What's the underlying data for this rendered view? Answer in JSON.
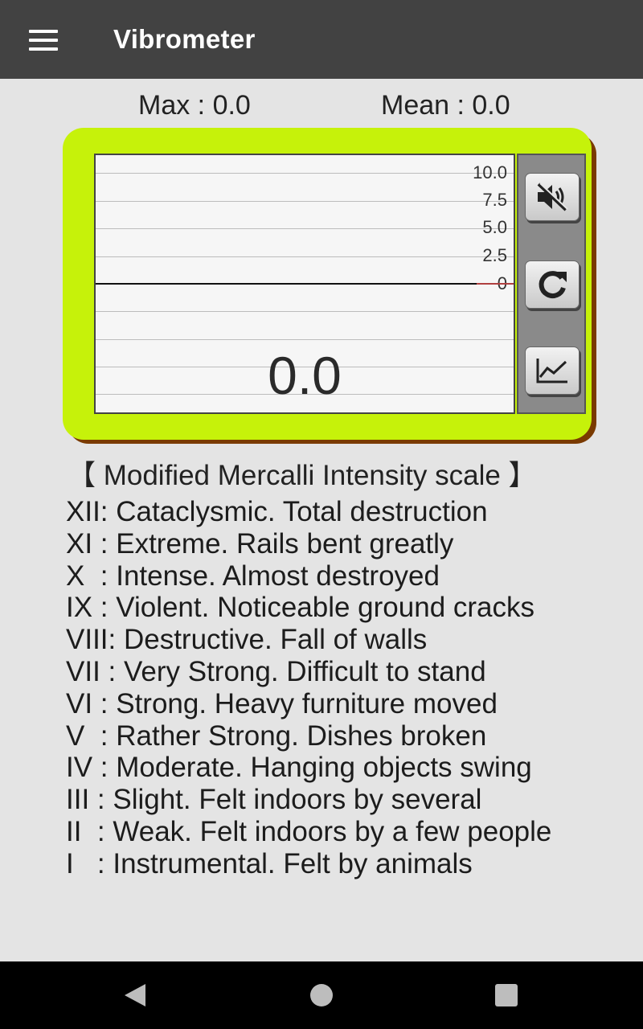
{
  "app": {
    "title": "Vibrometer"
  },
  "stats": {
    "max": "Max : 0.0",
    "mean": "Mean : 0.0"
  },
  "graph": {
    "ticks": [
      "10.0",
      "7.5",
      "5.0",
      "2.5",
      "0"
    ],
    "current_value": "0.0",
    "colors": {
      "panel": "#c6f20a",
      "panel_shadow": "#7a3a00",
      "trace": "#111111"
    }
  },
  "controls": {
    "mute_icon": "speaker-muted-icon",
    "reset_icon": "refresh-icon",
    "chart_icon": "line-chart-icon"
  },
  "scale": {
    "title": "【 Modified Mercalli Intensity scale 】",
    "items": [
      "XII: Cataclysmic. Total destruction",
      "XI : Extreme. Rails bent greatly",
      "X  : Intense. Almost destroyed",
      "IX : Violent. Noticeable ground cracks",
      "VIII: Destructive. Fall of walls",
      "VII : Very Strong. Difficult to stand",
      "VI : Strong. Heavy furniture moved",
      "V  : Rather Strong. Dishes broken",
      "IV : Moderate. Hanging objects swing",
      "III : Slight. Felt indoors by several",
      "II  : Weak. Felt indoors by a few people",
      "I   : Instrumental. Felt by animals"
    ]
  },
  "navigation": {
    "back_icon": "back-triangle-icon",
    "home_icon": "home-circle-icon",
    "recents_icon": "recents-square-icon"
  }
}
